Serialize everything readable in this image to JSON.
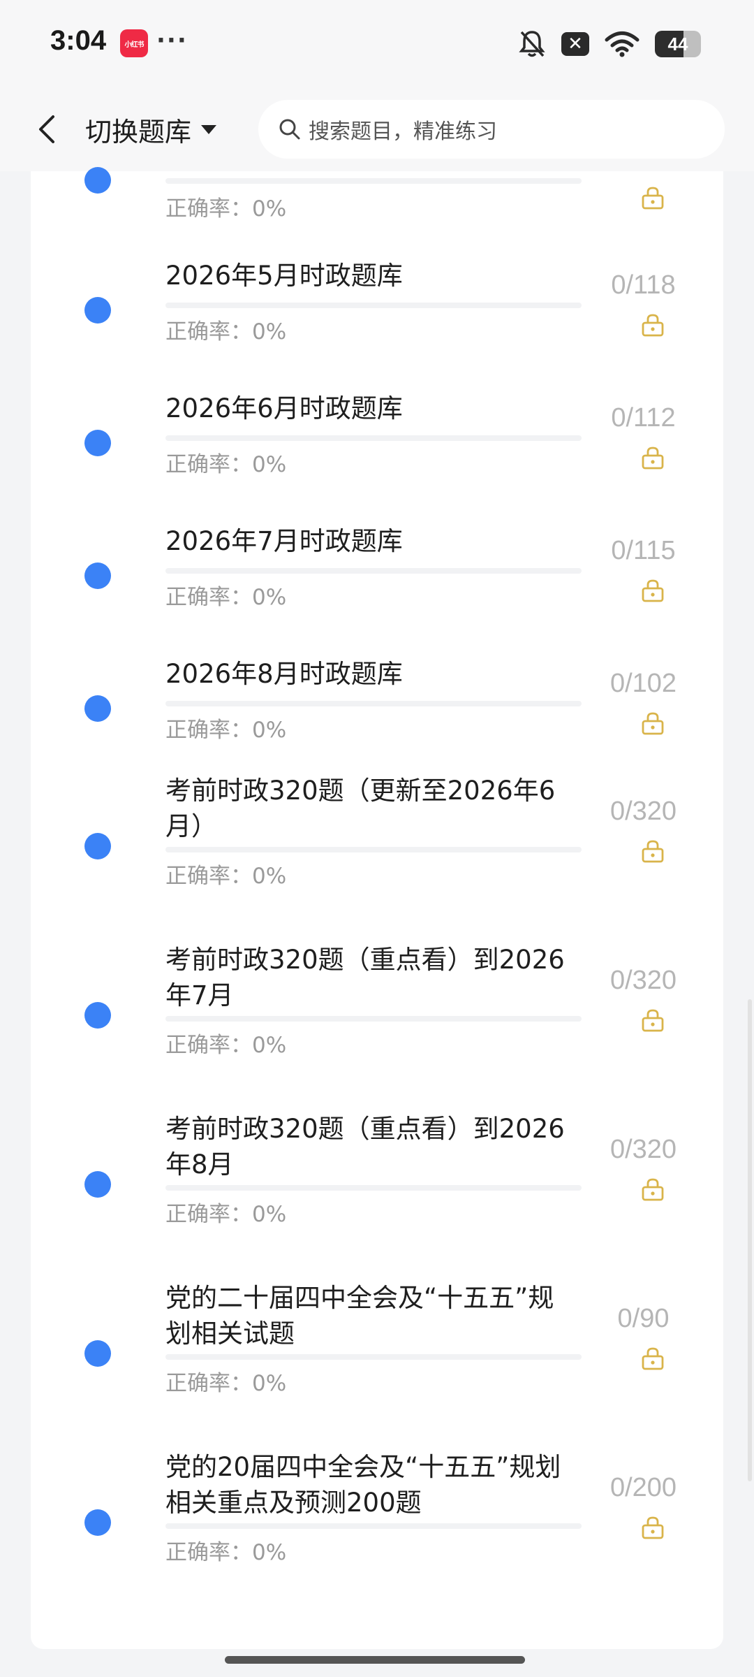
{
  "status_bar": {
    "time": "3:04",
    "app_badge": "小红书",
    "dots": "···",
    "battery": "44"
  },
  "header": {
    "switch_label": "切换题库",
    "search_placeholder": "搜索题目，精准练习"
  },
  "accent_color": "#3b82f6",
  "lock_color": "#d9b44a",
  "items": [
    {
      "title": "",
      "accuracy": "正确率：0%",
      "count": "",
      "progress": 0
    },
    {
      "title": "2026年5月时政题库",
      "accuracy": "正确率：0%",
      "count": "0/118",
      "progress": 0
    },
    {
      "title": "2026年6月时政题库",
      "accuracy": "正确率：0%",
      "count": "0/112",
      "progress": 0
    },
    {
      "title": "2026年7月时政题库",
      "accuracy": "正确率：0%",
      "count": "0/115",
      "progress": 0
    },
    {
      "title": "2026年8月时政题库",
      "accuracy": "正确率：0%",
      "count": "0/102",
      "progress": 0
    },
    {
      "title": "考前时政320题（更新至2026年6月）",
      "accuracy": "正确率：0%",
      "count": "0/320",
      "progress": 0
    },
    {
      "title": "考前时政320题（重点看）到2026年7月",
      "accuracy": "正确率：0%",
      "count": "0/320",
      "progress": 0
    },
    {
      "title": "考前时政320题（重点看）到2026年8月",
      "accuracy": "正确率：0%",
      "count": "0/320",
      "progress": 0
    },
    {
      "title": "党的二十届四中全会及“十五五”规划相关试题",
      "accuracy": "正确率：0%",
      "count": "0/90",
      "progress": 0
    },
    {
      "title": "党的20届四中全会及“十五五”规划相关重点及预测200题",
      "accuracy": "正确率：0%",
      "count": "0/200",
      "progress": 0
    }
  ]
}
